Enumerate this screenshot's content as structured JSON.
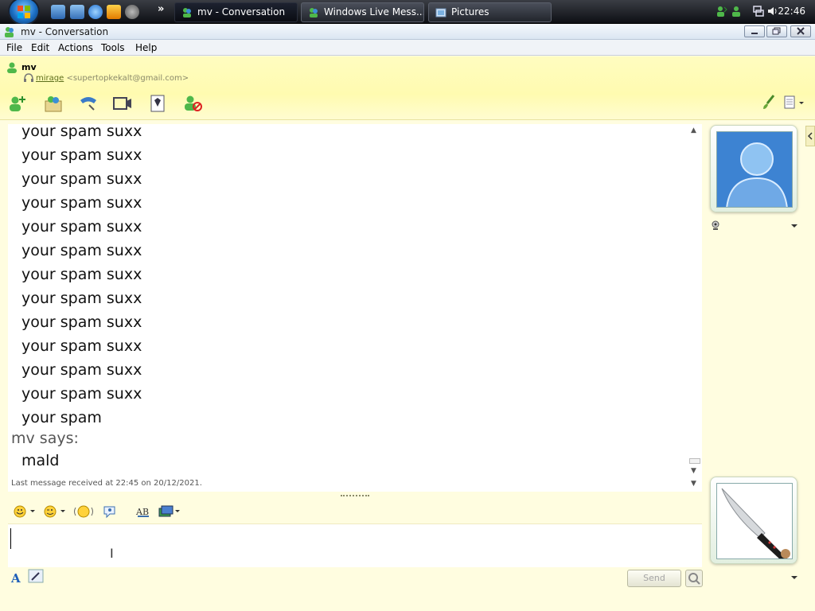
{
  "taskbar": {
    "tasks": [
      {
        "label": "mv - Conversation"
      },
      {
        "label": "Windows Live Mess..."
      },
      {
        "label": "Pictures"
      }
    ],
    "clock": "22:46"
  },
  "window": {
    "title": "mv - Conversation"
  },
  "menu": [
    "File",
    "Edit",
    "Actions",
    "Tools",
    "Help"
  ],
  "contact": {
    "name": "mv",
    "nickname": "mirage",
    "email": "<supertopkekalt@gmail.com>"
  },
  "chat": {
    "lines": [
      "your spam suxx",
      "your spam suxx",
      "your spam suxx",
      "your spam suxx",
      "your spam suxx",
      "your spam suxx",
      "your spam suxx",
      "your spam suxx",
      "your spam suxx",
      "your spam suxx",
      "your spam suxx",
      "your spam suxx",
      "your spam"
    ],
    "sender_label": "mv says:",
    "last_message_text": "mald",
    "last_received": "Last message received at 22:45 on 20/12/2021."
  },
  "compose": {
    "value": "",
    "send_label": "Send"
  },
  "colors": {
    "window_bg": "#fffde0",
    "header_bg": "#fffbb0"
  }
}
